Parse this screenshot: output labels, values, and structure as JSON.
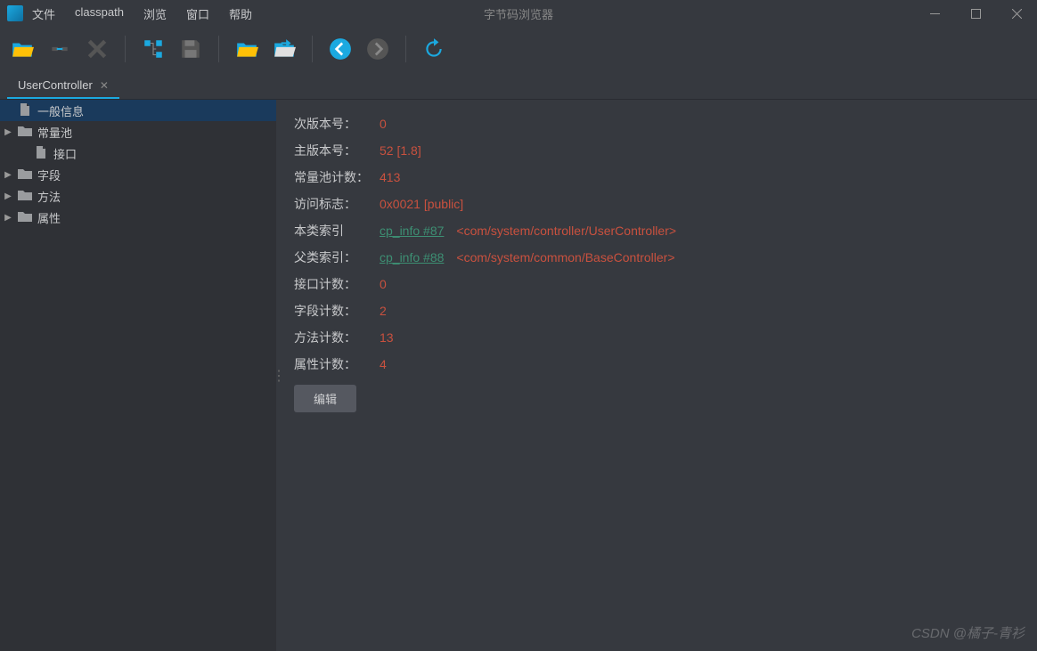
{
  "window": {
    "title": "字节码浏览器"
  },
  "menu": [
    "文件",
    "classpath",
    "浏览",
    "窗口",
    "帮助"
  ],
  "tab": {
    "label": "UserController"
  },
  "tree": [
    {
      "label": "一般信息",
      "icon": "file",
      "selected": true,
      "expandable": false
    },
    {
      "label": "常量池",
      "icon": "folder",
      "expandable": true
    },
    {
      "label": "接口",
      "icon": "file",
      "expandable": false,
      "indent": true
    },
    {
      "label": "字段",
      "icon": "folder",
      "expandable": true
    },
    {
      "label": "方法",
      "icon": "folder",
      "expandable": true
    },
    {
      "label": "属性",
      "icon": "folder",
      "expandable": true
    }
  ],
  "details": {
    "minor_version": {
      "label": "次版本号：",
      "value": "0"
    },
    "major_version": {
      "label": "主版本号：",
      "value": "52 [1.8]"
    },
    "cp_count": {
      "label": "常量池计数：",
      "value": "413"
    },
    "access_flags": {
      "label": "访问标志：",
      "value": "0x0021 [public]"
    },
    "this_class": {
      "label": "本类索引",
      "link": "cp_info #87",
      "class": "<com/system/controller/UserController>"
    },
    "super_class": {
      "label": "父类索引：",
      "link": "cp_info #88",
      "class": "<com/system/common/BaseController>"
    },
    "interface_count": {
      "label": "接口计数：",
      "value": "0"
    },
    "field_count": {
      "label": "字段计数：",
      "value": "2"
    },
    "method_count": {
      "label": "方法计数：",
      "value": "13"
    },
    "attr_count": {
      "label": "属性计数：",
      "value": "4"
    },
    "edit_button": "编辑"
  },
  "watermark": "CSDN @橘子-青衫"
}
